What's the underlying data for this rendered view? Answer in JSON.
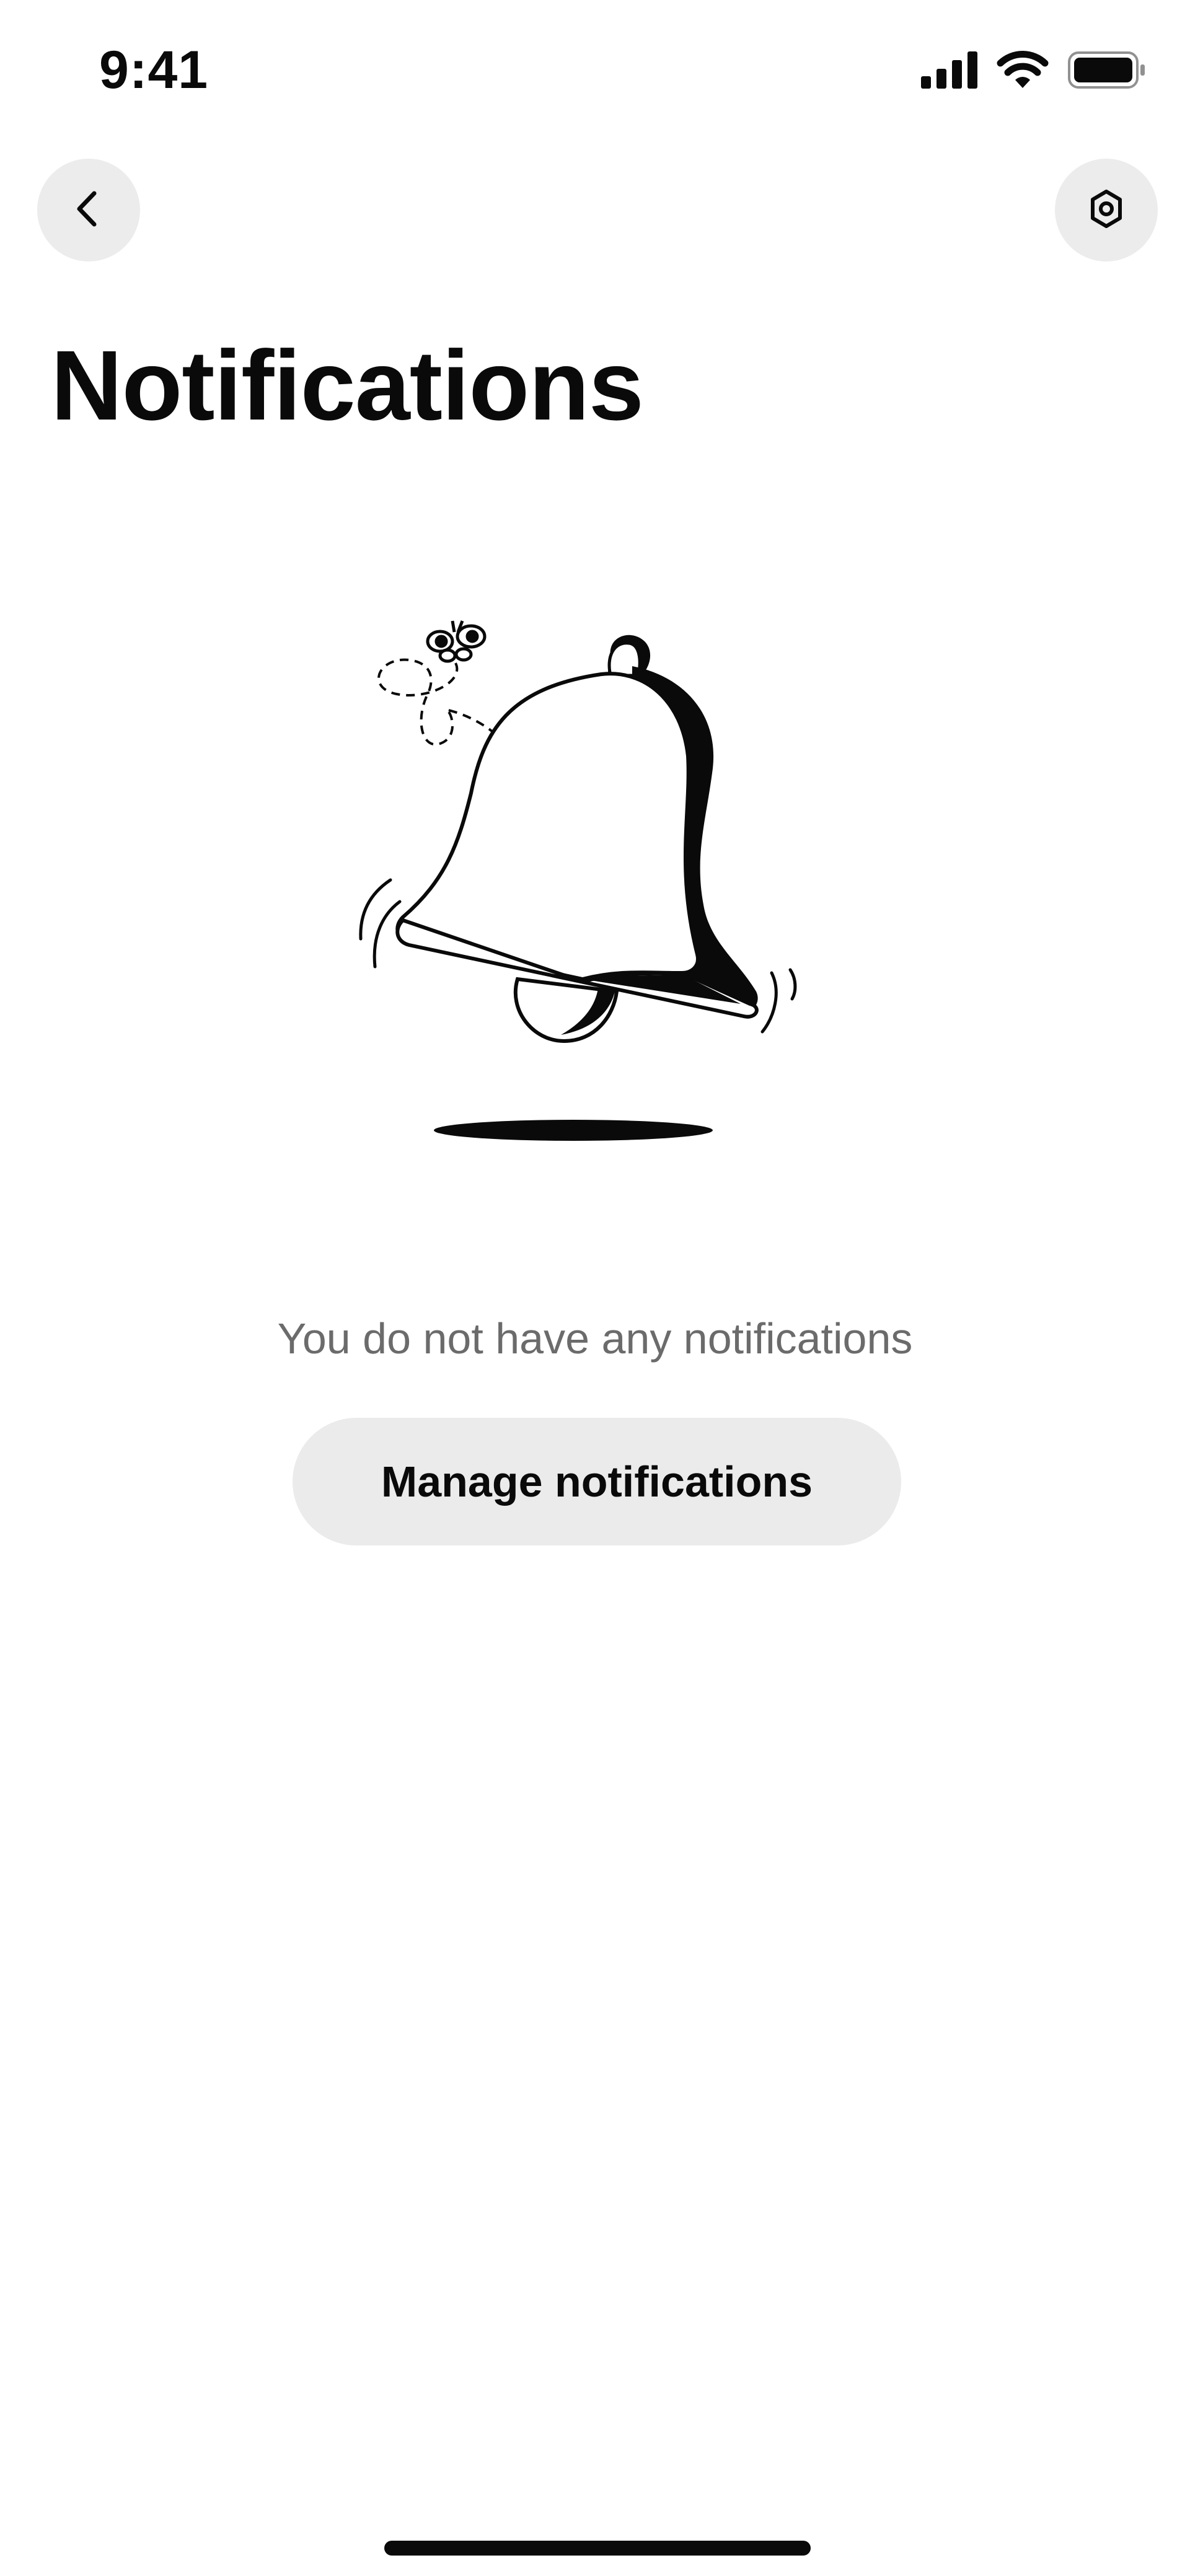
{
  "status_bar": {
    "time": "9:41",
    "icons": [
      "signal-icon",
      "wifi-icon",
      "battery-icon"
    ]
  },
  "header": {
    "back_icon": "chevron-left-icon",
    "settings_icon": "gear-icon",
    "title": "Notifications"
  },
  "empty_state": {
    "illustration": "bell-illustration",
    "message": "You do not have any notifications",
    "button_label": "Manage notifications"
  },
  "colors": {
    "background": "#ffffff",
    "button_bg": "#ebebeb",
    "text_primary": "#0a0a0a",
    "text_secondary": "#6b6b6b"
  }
}
